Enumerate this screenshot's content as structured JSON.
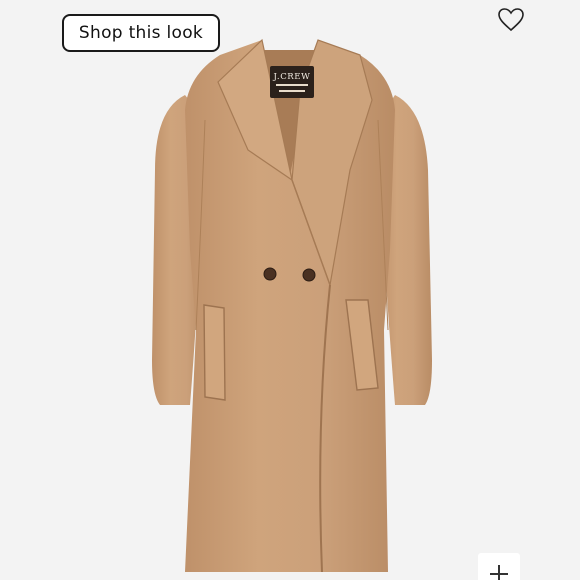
{
  "toolbar": {
    "shop_label": "Shop this look"
  },
  "product": {
    "brand_label": "J.CREW"
  },
  "icons": {
    "favorite": "heart-icon",
    "add": "plus-icon"
  },
  "colors": {
    "coat": "#c79a72",
    "background": "#f3f3f3"
  }
}
